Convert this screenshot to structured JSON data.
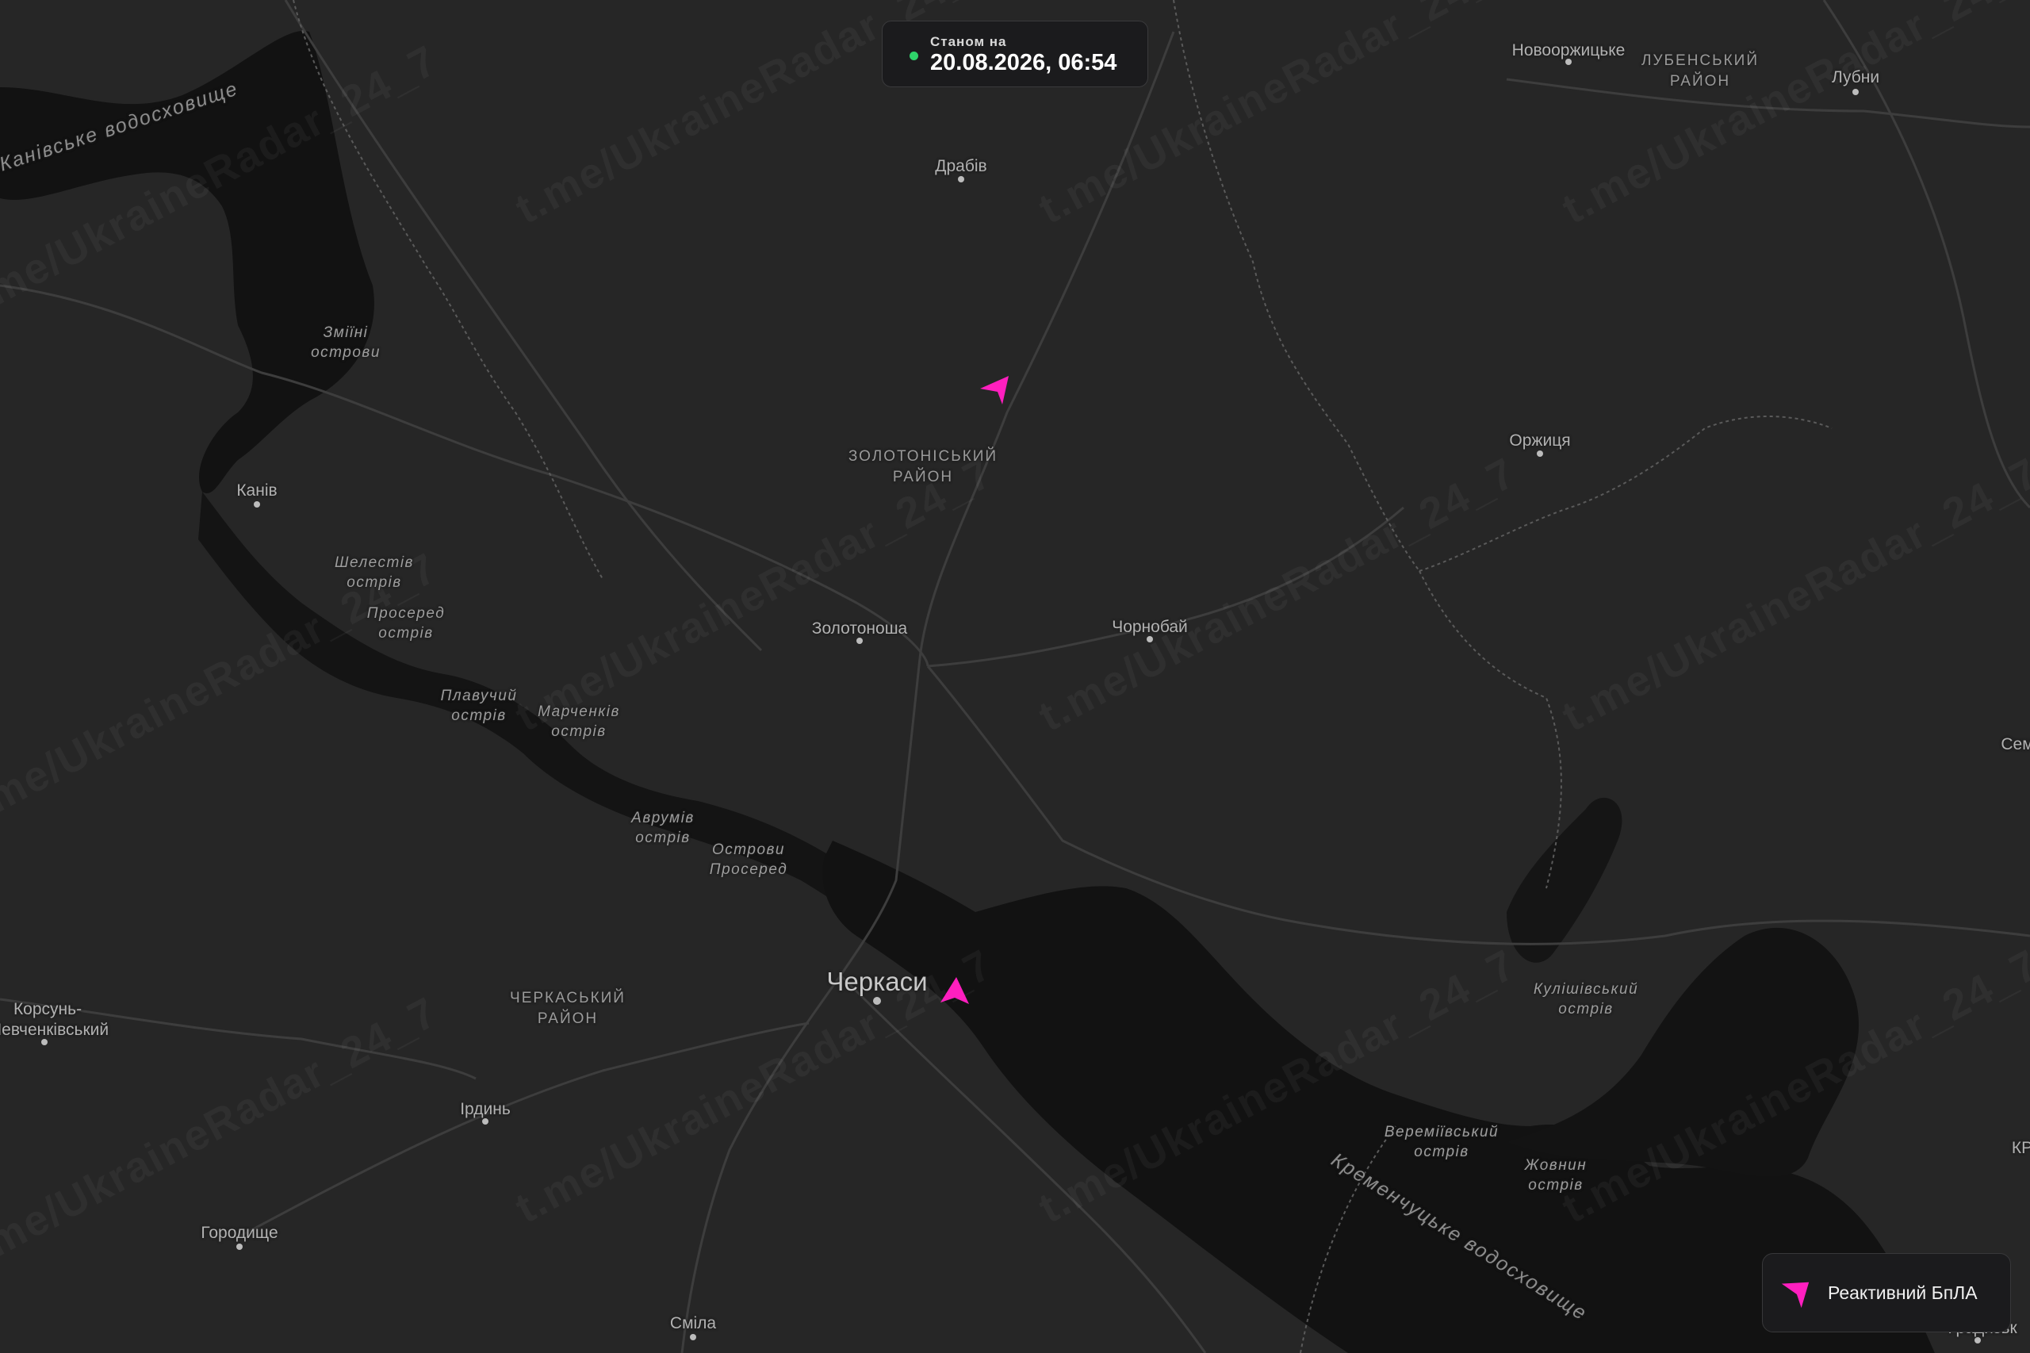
{
  "status": {
    "caption": "Станом на",
    "timestamp": "20.08.2026, 06:54",
    "indicator_color": "#2fd36a"
  },
  "legend": {
    "items": [
      {
        "label": "Реактивний БпЛА",
        "icon": "jet-drone-icon",
        "color": "#ff1fbf"
      }
    ]
  },
  "watermark": "t.me/UkraineRadar_24_7",
  "map": {
    "cities": [
      {
        "name": "Черкаси"
      }
    ],
    "towns": [
      {
        "name": "Драбів"
      },
      {
        "name": "Канів"
      },
      {
        "name": "Золотоноша"
      },
      {
        "name": "Чорнобай"
      },
      {
        "name": "Оржиця"
      },
      {
        "name": "Новооржицьке"
      },
      {
        "name": "Лубни"
      },
      {
        "name": "Корсунь-\nШевченківський"
      },
      {
        "name": "Ірдинь"
      },
      {
        "name": "Городище"
      },
      {
        "name": "Сміла"
      },
      {
        "name": "Сем"
      },
      {
        "name": "Градизьк"
      },
      {
        "name": "КР"
      }
    ],
    "districts": [
      {
        "name": "ЗОЛОТОНІСЬКИЙ\nРАЙОН"
      },
      {
        "name": "ЧЕРКАСЬКИЙ\nРАЙОН"
      },
      {
        "name": "ЛУБЕНСЬКИЙ\nРАЙОН"
      }
    ],
    "islands": [
      {
        "name": "Зміїні\nострови"
      },
      {
        "name": "Шелестів\nострів"
      },
      {
        "name": "Просеред\nострів"
      },
      {
        "name": "Плавучий\nострів"
      },
      {
        "name": "Марченків\nострів"
      },
      {
        "name": "Аврумів\nострів"
      },
      {
        "name": "Острови\nПросеред"
      },
      {
        "name": "Кулішівський\nострів"
      },
      {
        "name": "Вереміївський\nострів"
      },
      {
        "name": "Жовнин\nострів"
      }
    ],
    "water": [
      {
        "name": "Канівське водосховище"
      },
      {
        "name": "Кременчуцьке водосховище"
      }
    ],
    "colors": {
      "land": "#262626",
      "water": "#121212",
      "road": "#3d3d3d",
      "border": "#5a5a5a",
      "drone": "#ff1fbf"
    }
  }
}
